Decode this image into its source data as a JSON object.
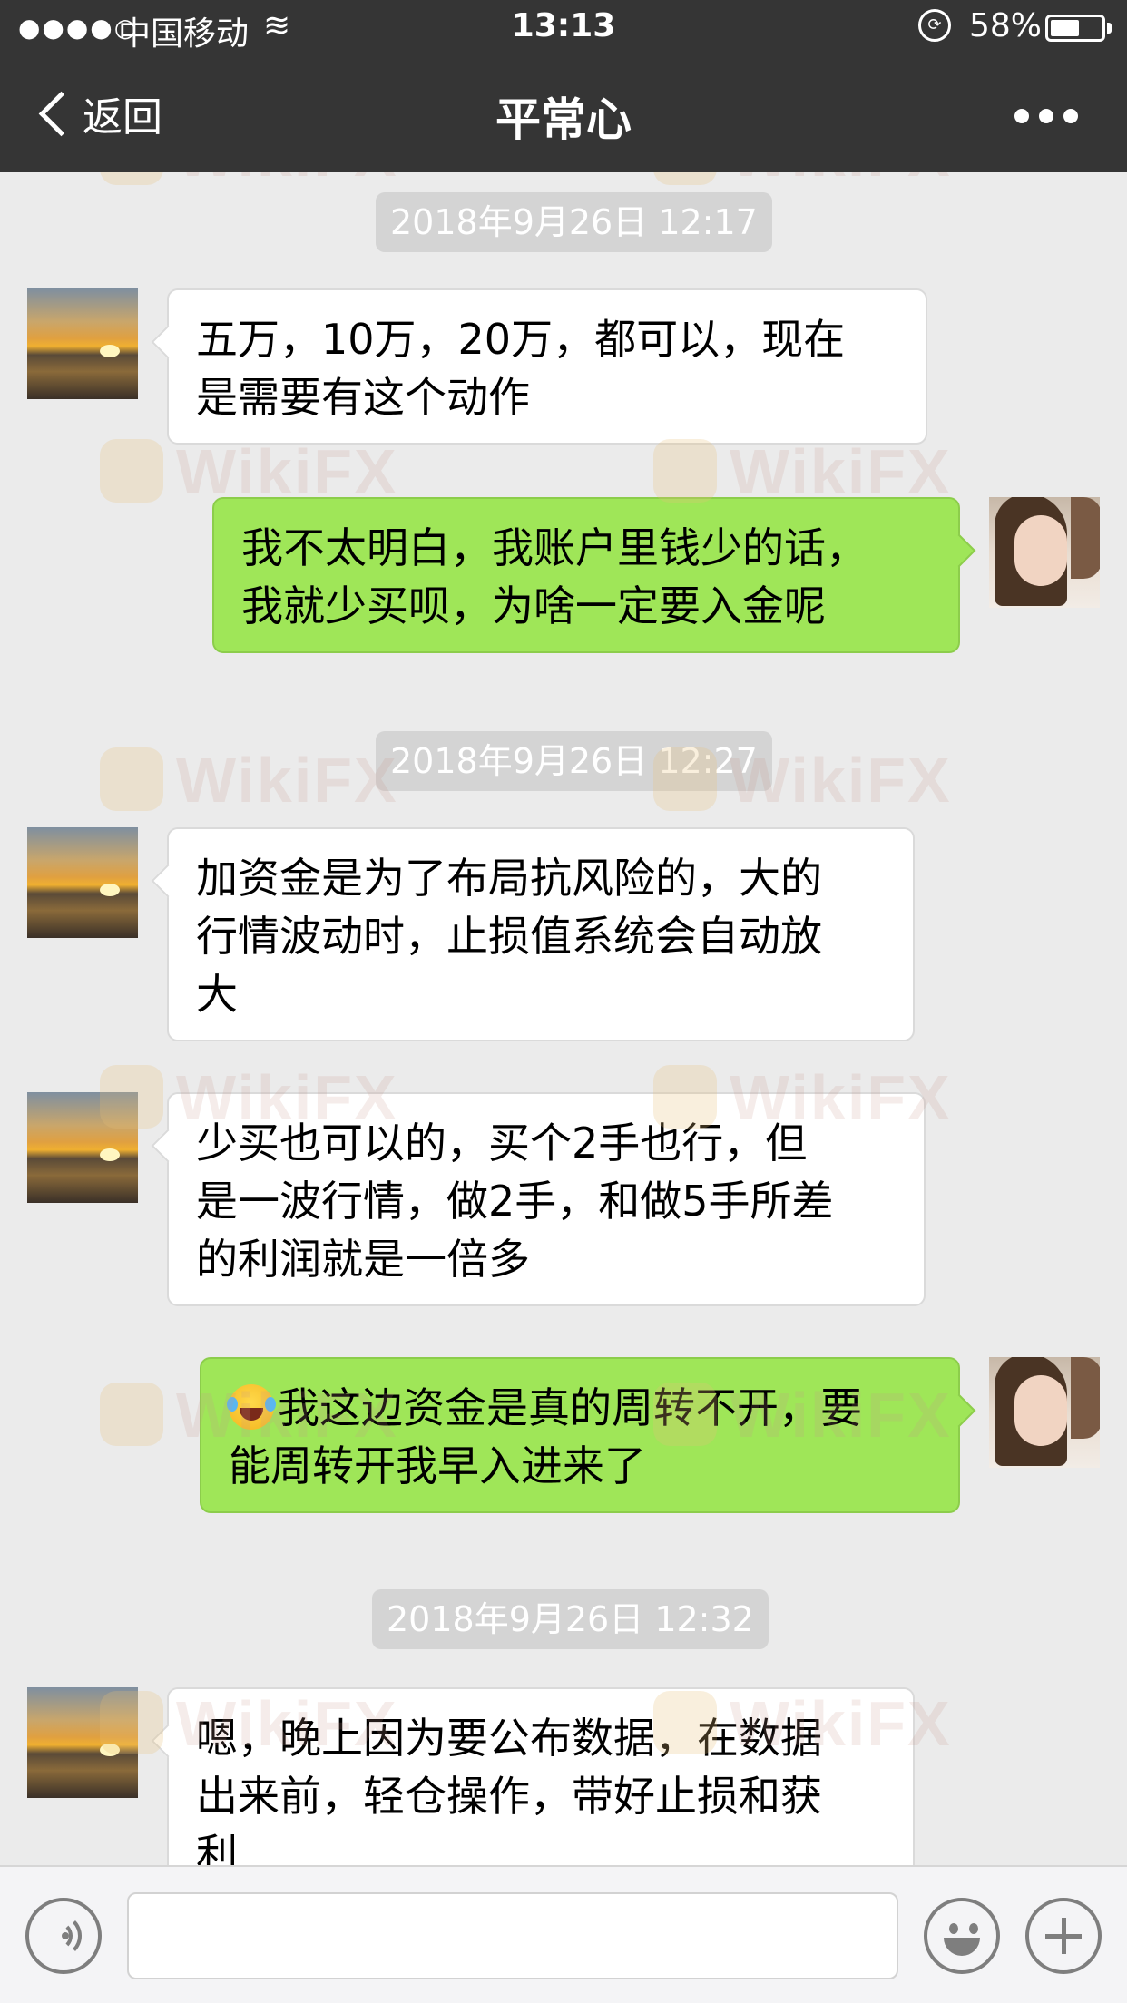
{
  "status_bar": {
    "signal": "●●●●○",
    "carrier": "中国移动",
    "wifi": "≋",
    "time": "13:13",
    "battery_percent": "58%",
    "battery_level": 0.58
  },
  "nav": {
    "back_label": "返回",
    "title": "平常心"
  },
  "watermark_text": "WikiFX",
  "messages": [
    {
      "type": "timestamp",
      "text": "2018年9月26日 12:17"
    },
    {
      "type": "incoming",
      "lines": [
        "五万，10万，20万，都可以，现在",
        "是需要有这个动作"
      ]
    },
    {
      "type": "outgoing",
      "lines": [
        "我不太明白，我账户里钱少的话，",
        "我就少买呗，为啥一定要入金呢"
      ]
    },
    {
      "type": "timestamp",
      "text": "2018年9月26日 12:27"
    },
    {
      "type": "incoming",
      "lines": [
        "加资金是为了布局抗风险的，大的",
        "行情波动时，止损值系统会自动放",
        "大"
      ]
    },
    {
      "type": "incoming",
      "lines": [
        "少买也可以的，买个2手也行，但",
        "是一波行情，做2手，和做5手所差",
        "的利润就是一倍多"
      ]
    },
    {
      "type": "outgoing",
      "emoji": "face-with-tears-of-joy",
      "lines": [
        "我这边资金是真的周转不开，要",
        "能周转开我早入进来了"
      ]
    },
    {
      "type": "timestamp",
      "text": "2018年9月26日 12:32"
    },
    {
      "type": "incoming",
      "lines": [
        "嗯，晚上因为要公布数据，在数据",
        "出来前，轻仓操作，带好止损和获",
        "利"
      ]
    }
  ],
  "input_bar": {
    "text_value": ""
  },
  "colors": {
    "header": "#353535",
    "chat_bg": "#ebebeb",
    "outgoing_bubble": "#9fe658",
    "incoming_bubble": "#ffffff",
    "timestamp_bg": "#d4d4d4"
  }
}
